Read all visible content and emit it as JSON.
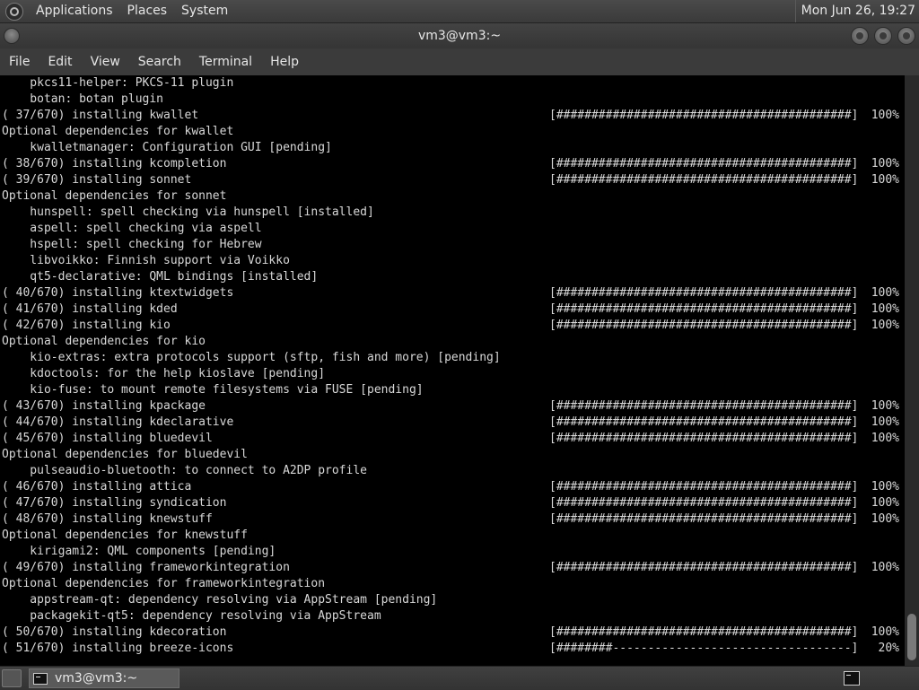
{
  "top_panel": {
    "menus": [
      "Applications",
      "Places",
      "System"
    ],
    "clock": "Mon Jun 26, 19:27"
  },
  "window": {
    "title": "vm3@vm3:~"
  },
  "menubar": [
    "File",
    "Edit",
    "View",
    "Search",
    "Terminal",
    "Help"
  ],
  "terminal": {
    "lines": [
      {
        "text": "    pkcs11-helper: PKCS-11 plugin"
      },
      {
        "text": "    botan: botan plugin"
      },
      {
        "text": "( 37/670) installing kwallet",
        "bar": "[##########################################]",
        "pct": "100%"
      },
      {
        "text": "Optional dependencies for kwallet"
      },
      {
        "text": "    kwalletmanager: Configuration GUI [pending]"
      },
      {
        "text": "( 38/670) installing kcompletion",
        "bar": "[##########################################]",
        "pct": "100%"
      },
      {
        "text": "( 39/670) installing sonnet",
        "bar": "[##########################################]",
        "pct": "100%"
      },
      {
        "text": "Optional dependencies for sonnet"
      },
      {
        "text": "    hunspell: spell checking via hunspell [installed]"
      },
      {
        "text": "    aspell: spell checking via aspell"
      },
      {
        "text": "    hspell: spell checking for Hebrew"
      },
      {
        "text": "    libvoikko: Finnish support via Voikko"
      },
      {
        "text": "    qt5-declarative: QML bindings [installed]"
      },
      {
        "text": "( 40/670) installing ktextwidgets",
        "bar": "[##########################################]",
        "pct": "100%"
      },
      {
        "text": "( 41/670) installing kded",
        "bar": "[##########################################]",
        "pct": "100%"
      },
      {
        "text": "( 42/670) installing kio",
        "bar": "[##########################################]",
        "pct": "100%"
      },
      {
        "text": "Optional dependencies for kio"
      },
      {
        "text": "    kio-extras: extra protocols support (sftp, fish and more) [pending]"
      },
      {
        "text": "    kdoctools: for the help kioslave [pending]"
      },
      {
        "text": "    kio-fuse: to mount remote filesystems via FUSE [pending]"
      },
      {
        "text": "( 43/670) installing kpackage",
        "bar": "[##########################################]",
        "pct": "100%"
      },
      {
        "text": "( 44/670) installing kdeclarative",
        "bar": "[##########################################]",
        "pct": "100%"
      },
      {
        "text": "( 45/670) installing bluedevil",
        "bar": "[##########################################]",
        "pct": "100%"
      },
      {
        "text": "Optional dependencies for bluedevil"
      },
      {
        "text": "    pulseaudio-bluetooth: to connect to A2DP profile"
      },
      {
        "text": "( 46/670) installing attica",
        "bar": "[##########################################]",
        "pct": "100%"
      },
      {
        "text": "( 47/670) installing syndication",
        "bar": "[##########################################]",
        "pct": "100%"
      },
      {
        "text": "( 48/670) installing knewstuff",
        "bar": "[##########################################]",
        "pct": "100%"
      },
      {
        "text": "Optional dependencies for knewstuff"
      },
      {
        "text": "    kirigami2: QML components [pending]"
      },
      {
        "text": "( 49/670) installing frameworkintegration",
        "bar": "[##########################################]",
        "pct": "100%"
      },
      {
        "text": "Optional dependencies for frameworkintegration"
      },
      {
        "text": "    appstream-qt: dependency resolving via AppStream [pending]"
      },
      {
        "text": "    packagekit-qt5: dependency resolving via AppStream"
      },
      {
        "text": "( 50/670) installing kdecoration",
        "bar": "[##########################################]",
        "pct": "100%"
      },
      {
        "text": "( 51/670) installing breeze-icons",
        "bar": "[########----------------------------------]",
        "pct": "20%"
      }
    ]
  },
  "taskbar": {
    "task_label": "vm3@vm3:~"
  },
  "icons": {
    "app_logo": "applications-logo-icon",
    "task": "terminal-icon",
    "tray": "terminal-icon"
  }
}
